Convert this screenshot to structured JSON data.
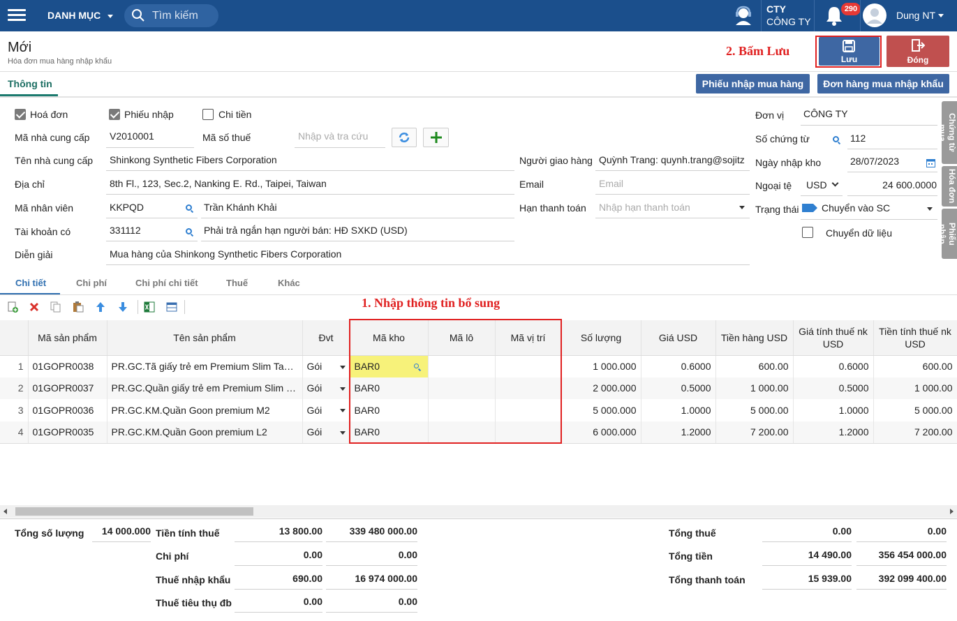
{
  "topbar": {
    "menu_label": "DANH MỤC",
    "search_placeholder": "Tìm kiếm",
    "company_short": "CTY",
    "company_name": "CÔNG TY",
    "notif_count": "290",
    "user_name": "Dung NT"
  },
  "header": {
    "title": "Mới",
    "subtitle": "Hóa đơn mua hàng nhập khẩu",
    "annotation_save": "2. Bấm Lưu",
    "save_label": "Lưu",
    "close_label": "Đóng"
  },
  "tabs": {
    "info": "Thông tin",
    "btn_receipt": "Phiếu nhập mua hàng",
    "btn_order": "Đơn hàng mua nhập khẩu"
  },
  "form": {
    "cb_invoice": "Hoá đơn",
    "cb_receipt": "Phiếu nhập",
    "cb_payment": "Chi tiền",
    "supplier_code_label": "Mã nhà cung cấp",
    "supplier_code": "V2010001",
    "tax_code_label": "Mã số thuế",
    "tax_code_placeholder": "Nhập và tra cứu",
    "supplier_name_label": "Tên nhà cung cấp",
    "supplier_name": "Shinkong Synthetic Fibers Corporation",
    "address_label": "Địa chỉ",
    "address": "8th Fl., 123, Sec.2, Nanking E. Rd.,  Taipei, Taiwan",
    "employee_label": "Mã nhân viên",
    "employee_code": "KKPQD",
    "employee_name": "Trần Khánh Khải",
    "account_label": "Tài khoản có",
    "account_code": "331112",
    "account_name": "Phải trả ngắn hạn người bán: HĐ SXKD (USD)",
    "desc_label": "Diễn giải",
    "desc": "Mua hàng của Shinkong Synthetic Fibers Corporation",
    "deliverer_label": "Người giao hàng",
    "deliverer": "Quỳnh Trang: quynh.trang@sojitz",
    "email_label": "Email",
    "email_placeholder": "Email",
    "due_label": "Hạn thanh toán",
    "due_placeholder": "Nhập hạn thanh toán",
    "unit_label": "Đơn vị",
    "unit": "CÔNG TY",
    "voucher_label": "Số chứng từ",
    "voucher": "112",
    "date_label": "Ngày nhập kho",
    "date": "28/07/2023",
    "currency_label": "Ngoại tệ",
    "currency": "USD",
    "rate": "24 600.0000",
    "status_label": "Trạng thái",
    "status": "Chuyển vào SC",
    "transfer_label": "Chuyển dữ liệu"
  },
  "side_tabs": [
    "Chứng từ mua",
    "Hóa đơn",
    "Phiếu nhập"
  ],
  "detail_tabs": [
    "Chi tiết",
    "Chi phí",
    "Chi phí chi tiết",
    "Thuế",
    "Khác"
  ],
  "annotation_fill": "1. Nhập thông tin bổ sung",
  "grid": {
    "columns": [
      "Mã sản phẩm",
      "Tên sản phẩm",
      "Đvt",
      "Mã kho",
      "Mã lô",
      "Mã vị trí",
      "Số lượng",
      "Giá USD",
      "Tiền hàng USD",
      "Giá tính thuế nk USD",
      "Tiền tính thuế nk USD"
    ],
    "rows": [
      {
        "no": "1",
        "code": "01GOPR0038",
        "name": "PR.GC.Tã giấy trẻ em Premium Slim Tape S1...",
        "unit": "Gói",
        "wh": "BAR0",
        "lot": "",
        "loc": "",
        "qty": "1 000.000",
        "price": "0.6000",
        "amount": "600.00",
        "tax_price": "0.6000",
        "tax_amount": "600.00"
      },
      {
        "no": "2",
        "code": "01GOPR0037",
        "name": "PR.GC.Quần giấy trẻ em Premium Slim pan...",
        "unit": "Gói",
        "wh": "BAR0",
        "lot": "",
        "loc": "",
        "qty": "2 000.000",
        "price": "0.5000",
        "amount": "1 000.00",
        "tax_price": "0.5000",
        "tax_amount": "1 000.00"
      },
      {
        "no": "3",
        "code": "01GOPR0036",
        "name": "PR.GC.KM.Quần Goon premium M2",
        "unit": "Gói",
        "wh": "BAR0",
        "lot": "",
        "loc": "",
        "qty": "5 000.000",
        "price": "1.0000",
        "amount": "5 000.00",
        "tax_price": "1.0000",
        "tax_amount": "5 000.00"
      },
      {
        "no": "4",
        "code": "01GOPR0035",
        "name": "PR.GC.KM.Quần Goon premium L2",
        "unit": "Gói",
        "wh": "BAR0",
        "lot": "",
        "loc": "",
        "qty": "6 000.000",
        "price": "1.2000",
        "amount": "7 200.00",
        "tax_price": "1.2000",
        "tax_amount": "7 200.00"
      }
    ]
  },
  "totals": {
    "qty_label": "Tổng số lượng",
    "qty": "14 000.000",
    "taxbase_label": "Tiền tính thuế",
    "taxbase_usd": "13 800.00",
    "taxbase_vnd": "339 480 000.00",
    "cost_label": "Chi phí",
    "cost_usd": "0.00",
    "cost_vnd": "0.00",
    "import_tax_label": "Thuế nhập khẩu",
    "import_tax_usd": "690.00",
    "import_tax_vnd": "16 974 000.00",
    "excise_label": "Thuế tiêu thụ đb",
    "excise_usd": "0.00",
    "excise_vnd": "0.00",
    "total_tax_label": "Tổng thuế",
    "total_tax_usd": "0.00",
    "total_tax_vnd": "0.00",
    "total_label": "Tổng tiền",
    "total_usd": "14 490.00",
    "total_vnd": "356 454 000.00",
    "pay_label": "Tổng thanh toán",
    "pay_usd": "15 939.00",
    "pay_vnd": "392 099 400.00"
  },
  "colors": {
    "topbar": "#1b4f8c",
    "primary_button": "#3e67a3",
    "close_button": "#c0504f",
    "annotation": "#e02020",
    "highlight": "#f7f27a"
  }
}
